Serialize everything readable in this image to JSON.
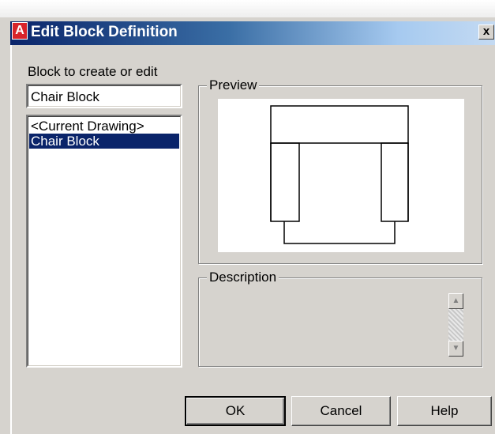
{
  "window": {
    "title": "Edit Block Definition",
    "app_icon_letter": "A",
    "close_glyph": "x"
  },
  "left_panel": {
    "label": "Block to create or edit",
    "name_input_value": "Chair Block",
    "list_items": [
      {
        "label": "<Current Drawing>",
        "selected": false
      },
      {
        "label": "Chair Block",
        "selected": true
      }
    ]
  },
  "preview": {
    "label": "Preview"
  },
  "description": {
    "label": "Description",
    "value": ""
  },
  "buttons": {
    "ok": "OK",
    "cancel": "Cancel",
    "help": "Help"
  },
  "colors": {
    "title_gradient_start": "#0a246a",
    "selection": "#0a246a",
    "dialog_face": "#d6d3ce"
  }
}
